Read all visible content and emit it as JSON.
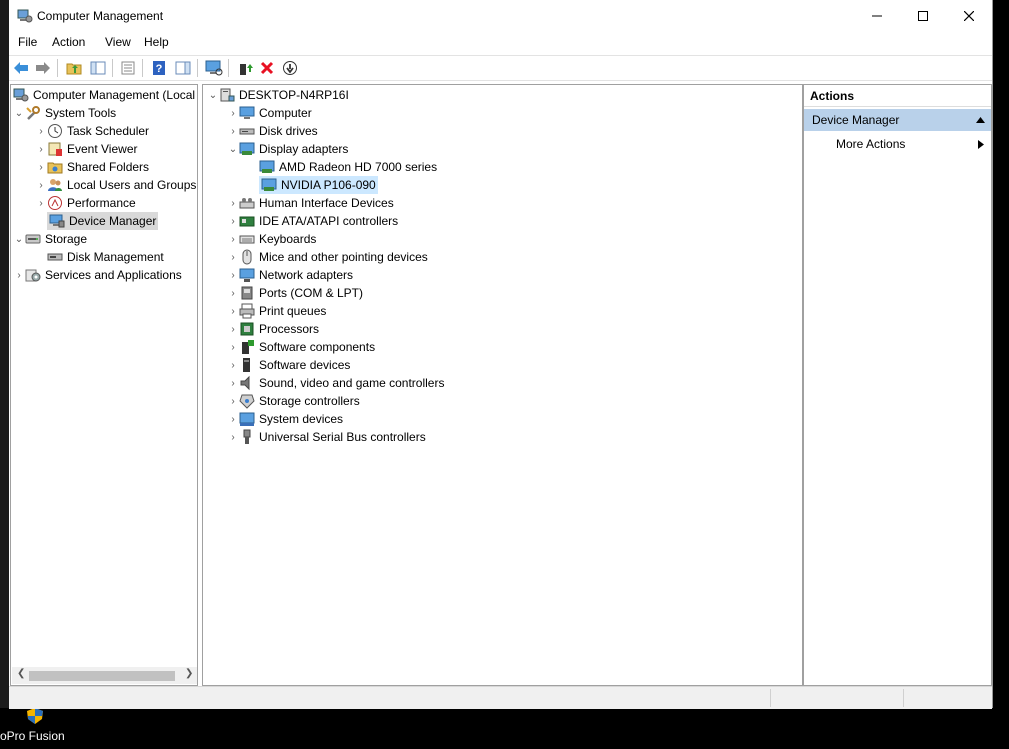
{
  "window": {
    "title": "Computer Management"
  },
  "menu": [
    "File",
    "Action",
    "View",
    "Help"
  ],
  "left_tree": {
    "root": "Computer Management (Local",
    "system_tools": "System Tools",
    "task_scheduler": "Task Scheduler",
    "event_viewer": "Event Viewer",
    "shared_folders": "Shared Folders",
    "local_users": "Local Users and Groups",
    "performance": "Performance",
    "device_manager": "Device Manager",
    "storage": "Storage",
    "disk_management": "Disk Management",
    "services": "Services and Applications"
  },
  "device_tree": {
    "computer_name": "DESKTOP-N4RP16I",
    "categories": [
      "Computer",
      "Disk drives",
      "Display adapters",
      "Human Interface Devices",
      "IDE ATA/ATAPI controllers",
      "Keyboards",
      "Mice and other pointing devices",
      "Network adapters",
      "Ports (COM & LPT)",
      "Print queues",
      "Processors",
      "Software components",
      "Software devices",
      "Sound, video and game controllers",
      "Storage controllers",
      "System devices",
      "Universal Serial Bus controllers"
    ],
    "display_adapters": [
      "AMD Radeon HD 7000 series",
      "NVIDIA P106-090"
    ]
  },
  "actions": {
    "header": "Actions",
    "section": "Device Manager",
    "more": "More Actions"
  },
  "desktop": {
    "label": "oPro Fusion"
  },
  "colors": {
    "selection": "#cce8ff",
    "actions_section": "#b9d1ea",
    "delete_red": "#e81123"
  }
}
